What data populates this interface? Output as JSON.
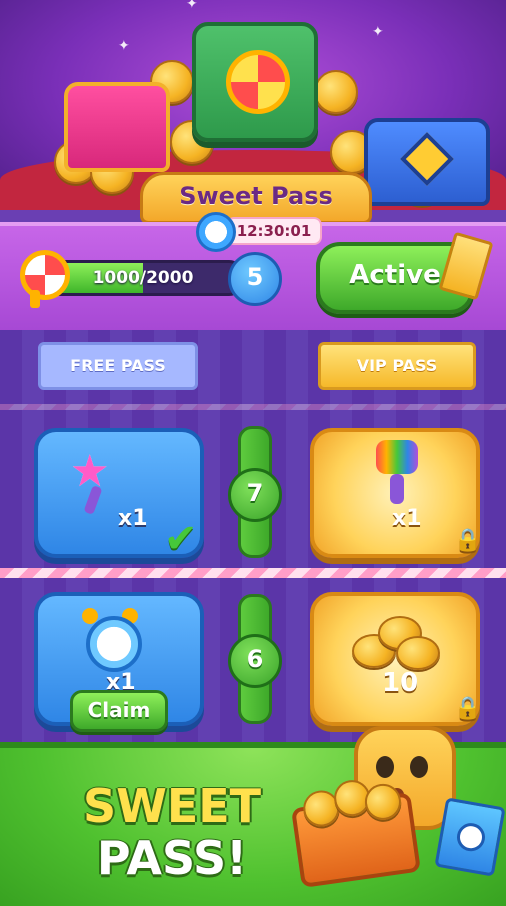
{
  "header": {
    "title": "Sweet Pass",
    "timer": "12:30:01"
  },
  "progress": {
    "text": "1000/2000",
    "current": 1000,
    "max": 2000,
    "level": "5",
    "status_button": "Active"
  },
  "tracks": {
    "free_label": "FREE PASS",
    "vip_label": "VIP PASS"
  },
  "rows": [
    {
      "level": "7",
      "free_reward": {
        "icon": "magic-wand-icon",
        "quantity": "x1",
        "claimed": true
      },
      "vip_reward": {
        "icon": "paint-brush-icon",
        "quantity": "x1",
        "locked": true
      }
    },
    {
      "level": "6",
      "free_reward": {
        "icon": "alarm-clock-icon",
        "quantity": "x1",
        "claim_label": "Claim"
      },
      "vip_reward": {
        "icon": "coin-stack-icon",
        "quantity": "10",
        "locked": true
      }
    }
  ],
  "promo": {
    "line1": "SWEET",
    "line2": "PASS!"
  },
  "colors": {
    "purple_bg": "#6a3fb3",
    "active_green": "#3ea92a",
    "gold": "#f5b323",
    "blue_card": "#2f86e6"
  }
}
